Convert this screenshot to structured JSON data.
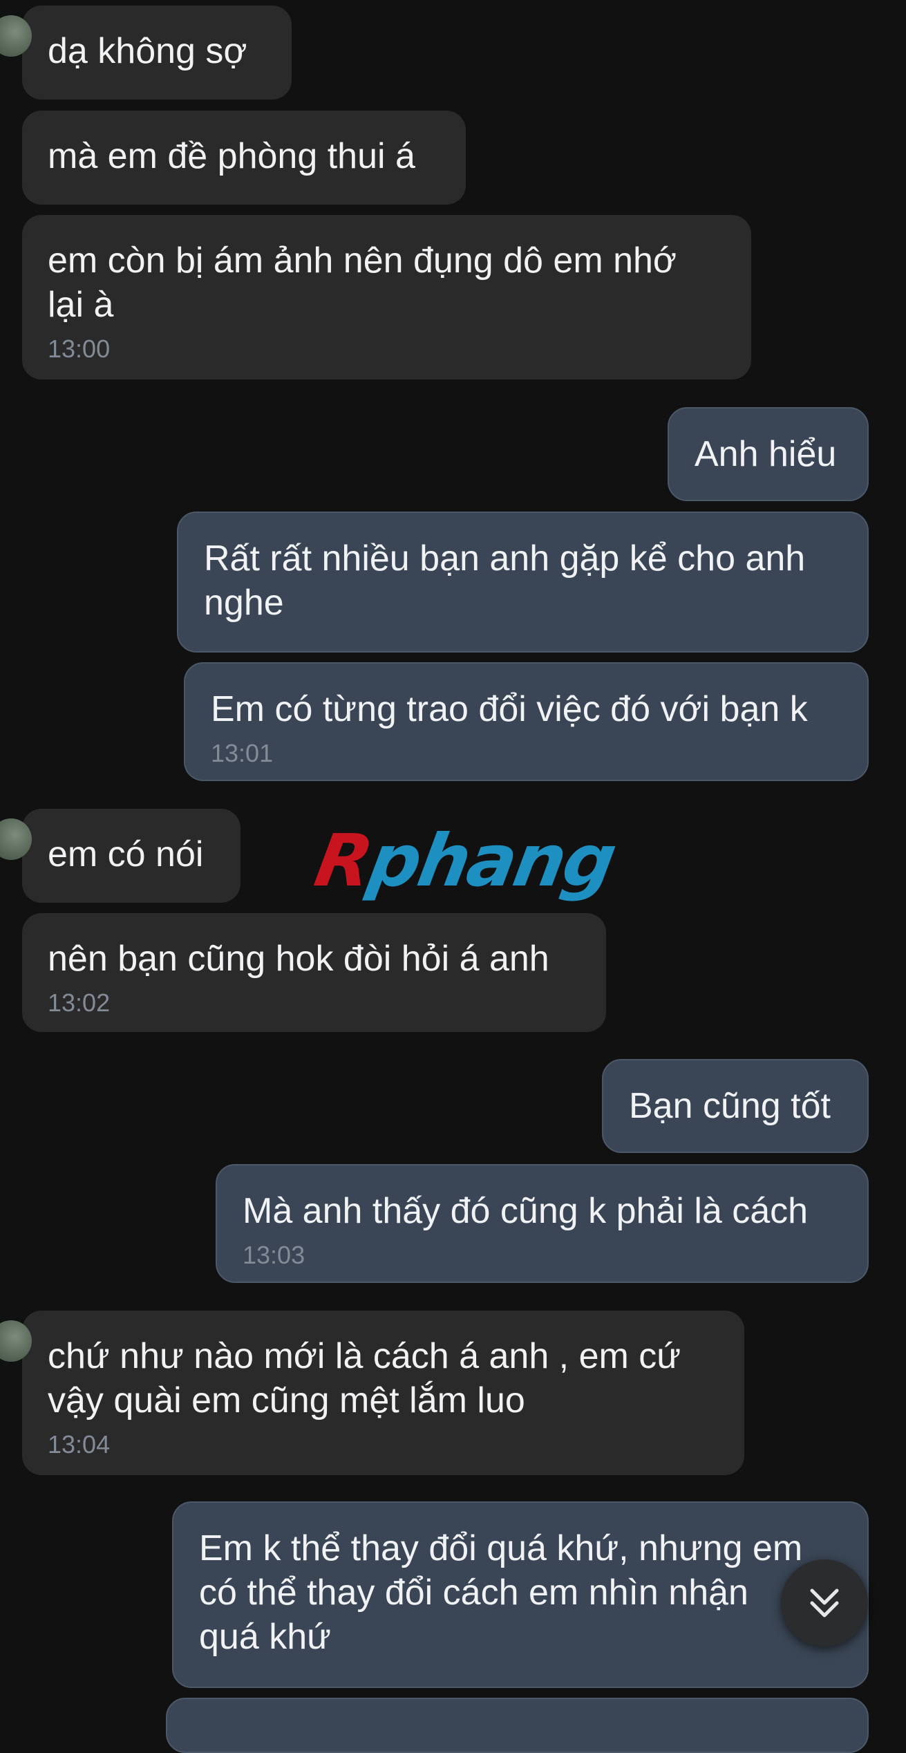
{
  "messages": [
    {
      "dir": "in",
      "text": "dạ không sợ",
      "time": ""
    },
    {
      "dir": "in",
      "text": "mà em đề phòng thui á",
      "time": ""
    },
    {
      "dir": "in",
      "text": "em còn bị ám ảnh nên đụng dô em nhớ\nlại à",
      "time": "13:00"
    },
    {
      "dir": "out",
      "text": "Anh hiểu",
      "time": ""
    },
    {
      "dir": "out",
      "text": "Rất rất nhiều bạn anh gặp kể cho anh\nnghe",
      "time": ""
    },
    {
      "dir": "out",
      "text": "Em có từng trao đổi việc đó với bạn k",
      "time": "13:01"
    },
    {
      "dir": "in",
      "text": "em có nói",
      "time": ""
    },
    {
      "dir": "in",
      "text": "nên bạn cũng hok đòi hỏi á anh",
      "time": "13:02"
    },
    {
      "dir": "out",
      "text": "Bạn cũng tốt",
      "time": ""
    },
    {
      "dir": "out",
      "text": "Mà anh thấy đó cũng k phải là cách",
      "time": "13:03"
    },
    {
      "dir": "in",
      "text": "chứ như nào mới là cách á anh , em cứ\nvậy quài em cũng mệt lắm luo",
      "time": "13:04"
    },
    {
      "dir": "out",
      "text": "Em k thể thay đổi quá khứ, nhưng em\ncó thể thay đổi cách em nhìn nhận\nquá khứ",
      "time": ""
    }
  ],
  "watermark": {
    "first": "R",
    "rest": "phang"
  },
  "scroll_button": {
    "icon": "double-chevron-down-icon"
  },
  "colors": {
    "background": "#111112",
    "incoming_bubble": "#2a2a2b",
    "outgoing_bubble": "#3a4655",
    "timestamp": "#838b96",
    "watermark_red": "#c8141f",
    "watermark_blue": "#1d8fc0"
  }
}
